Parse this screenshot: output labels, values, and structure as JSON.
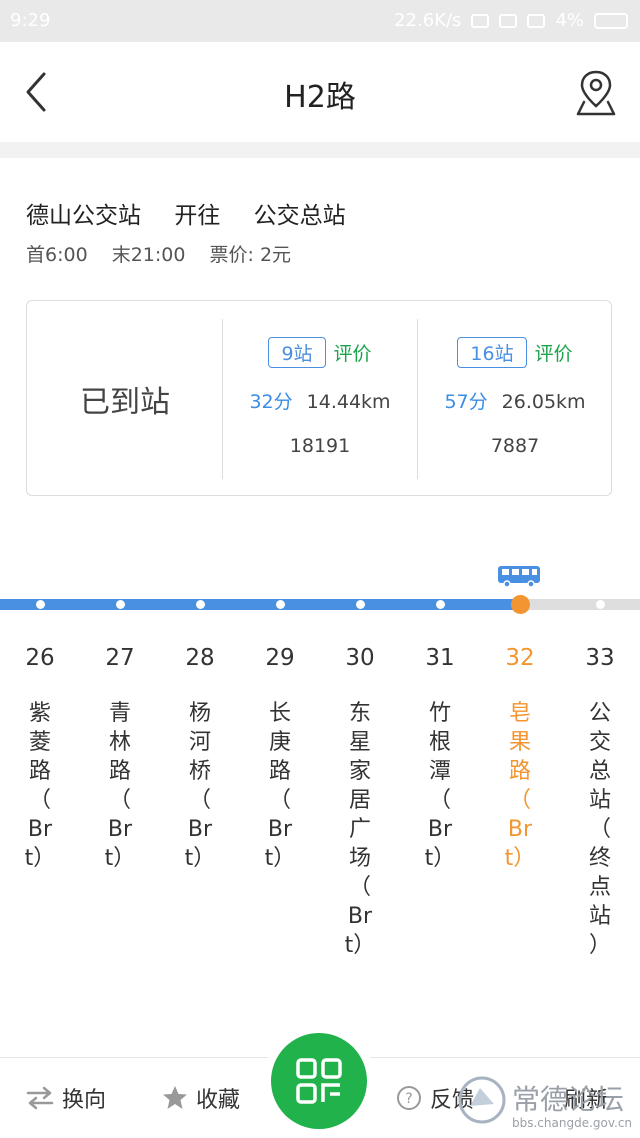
{
  "status_bar": {
    "time": "9:29",
    "network_speed": "22.6K/s",
    "battery": "4%"
  },
  "header": {
    "title": "H2路"
  },
  "route": {
    "from": "德山公交站",
    "direction_word": "开往",
    "to": "公交总站",
    "first_bus": "首6:00",
    "last_bus": "末21:00",
    "fare": "票价: 2元"
  },
  "card": {
    "status_text": "已到站",
    "buses": [
      {
        "stops_badge": "9站",
        "rate_label": "评价",
        "minutes": "32分",
        "distance": "14.44km",
        "bus_id": "18191"
      },
      {
        "stops_badge": "16站",
        "rate_label": "评价",
        "minutes": "57分",
        "distance": "26.05km",
        "bus_id": "7887"
      }
    ]
  },
  "stops": [
    {
      "num": "26",
      "name": [
        "紫",
        "菱",
        "路",
        "（",
        "Br",
        "t）"
      ]
    },
    {
      "num": "27",
      "name": [
        "青",
        "林",
        "路",
        "（",
        "Br",
        "t）"
      ]
    },
    {
      "num": "28",
      "name": [
        "杨",
        "河",
        "桥",
        "（",
        "Br",
        "t）"
      ]
    },
    {
      "num": "29",
      "name": [
        "长",
        "庚",
        "路",
        "（",
        "Br",
        "t）"
      ]
    },
    {
      "num": "30",
      "name": [
        "东",
        "星",
        "家",
        "居",
        "广",
        "场",
        "（",
        "Br",
        "t）"
      ]
    },
    {
      "num": "31",
      "name": [
        "竹",
        "根",
        "潭",
        "（",
        "Br",
        "t）"
      ]
    },
    {
      "num": "32",
      "name": [
        "皂",
        "果",
        "路",
        "（",
        "Br",
        "t）"
      ],
      "current": true
    },
    {
      "num": "33",
      "name": [
        "公",
        "交",
        "总",
        "站",
        "（",
        "终",
        "点",
        "站",
        "）"
      ]
    }
  ],
  "bottom_bar": {
    "reverse_label": "换向",
    "favorite_label": "收藏",
    "feedback_label": "反馈",
    "refresh_label": "刷新"
  },
  "watermark": {
    "text": "常德论坛",
    "url": "bbs.changde.gov.cn"
  },
  "colors": {
    "accent_blue": "#4a90e2",
    "current_orange": "#f39530",
    "green": "#21b24b"
  }
}
